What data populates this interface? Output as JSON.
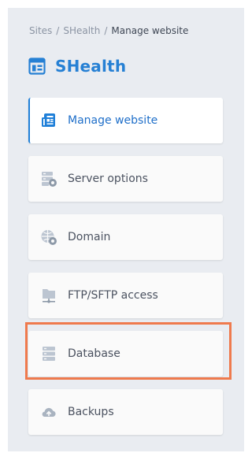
{
  "breadcrumb": {
    "items": [
      "Sites",
      "SHealth"
    ],
    "separator": "/",
    "current": "Manage website"
  },
  "site": {
    "title": "SHealth",
    "icon": "site-window-icon"
  },
  "colors": {
    "accent": "#1f7fd8",
    "highlight": "#ef7a4d",
    "panel": "#e9ecf1"
  },
  "menu": {
    "items": [
      {
        "label": "Manage website",
        "icon": "manage-website-icon",
        "active": true
      },
      {
        "label": "Server options",
        "icon": "server-options-icon",
        "active": false
      },
      {
        "label": "Domain",
        "icon": "domain-globe-icon",
        "active": false
      },
      {
        "label": "FTP/SFTP access",
        "icon": "ftp-folder-icon",
        "active": false
      },
      {
        "label": "Database",
        "icon": "database-icon",
        "active": false,
        "highlighted": true
      },
      {
        "label": "Backups",
        "icon": "backups-cloud-icon",
        "active": false
      }
    ]
  }
}
